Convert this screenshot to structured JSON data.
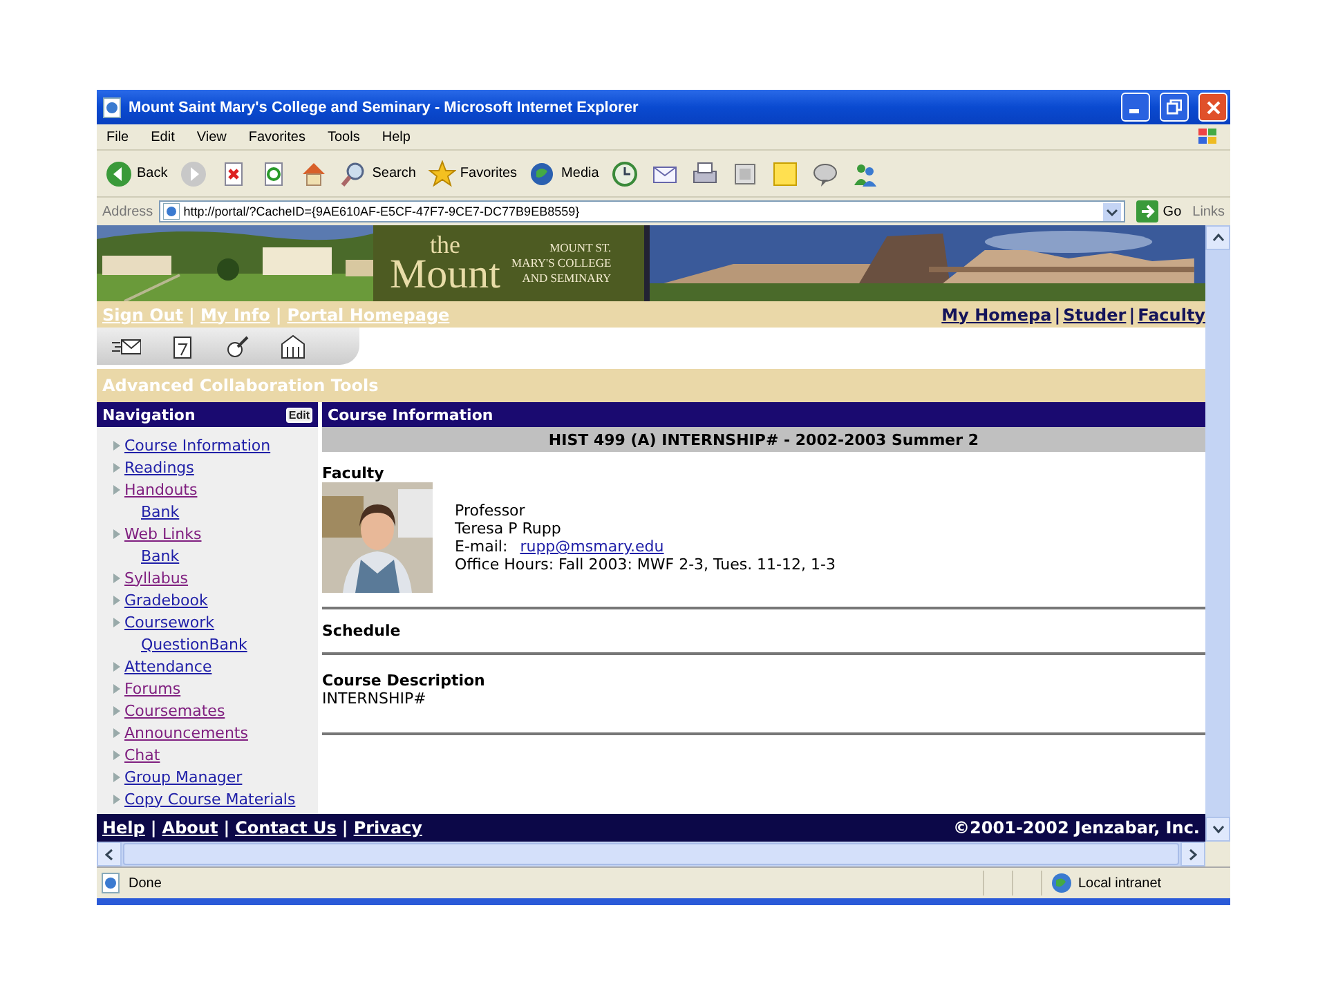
{
  "window": {
    "title": "Mount Saint Mary's College and Seminary - Microsoft Internet Explorer"
  },
  "menu": [
    "File",
    "Edit",
    "View",
    "Favorites",
    "Tools",
    "Help"
  ],
  "toolbar": [
    {
      "kind": "back",
      "label": "Back"
    },
    {
      "kind": "forward"
    },
    {
      "kind": "stop"
    },
    {
      "kind": "refresh"
    },
    {
      "kind": "home"
    },
    {
      "kind": "search",
      "label": "Search"
    },
    {
      "kind": "favorites",
      "label": "Favorites"
    },
    {
      "kind": "media",
      "label": "Media"
    },
    {
      "kind": "history"
    },
    {
      "kind": "mail"
    },
    {
      "kind": "print"
    },
    {
      "kind": "edit"
    },
    {
      "kind": "note"
    },
    {
      "kind": "discuss"
    },
    {
      "kind": "messenger"
    }
  ],
  "address": {
    "label": "Address",
    "value": "http://portal/?CacheID={9AE610AF-E5CF-47F7-9CE7-DC77B9EB8559}",
    "go": "Go",
    "links": "Links"
  },
  "banner": {
    "logo_small": "the",
    "logo_large": "Mount",
    "tagline": [
      "MOUNT ST.",
      "MARY'S COLLEGE",
      "AND SEMINARY"
    ]
  },
  "top_links": [
    "Sign Out",
    "My Info",
    "Portal Homepage"
  ],
  "tab_links": [
    "My Homepa",
    "Studer",
    "Faculty"
  ],
  "separator": "|",
  "portlet_tools": [
    {
      "kind": "mail"
    },
    {
      "kind": "calendar"
    },
    {
      "kind": "pen"
    },
    {
      "kind": "building"
    }
  ],
  "section_title": "Advanced Collaboration Tools",
  "navigation": {
    "title": "Navigation",
    "edit": "Edit",
    "items": [
      {
        "label": "Course Information",
        "visited": false
      },
      {
        "label": "Readings",
        "visited": false
      },
      {
        "label": "Handouts",
        "visited": true,
        "children": [
          {
            "label": "Bank",
            "visited": false
          }
        ]
      },
      {
        "label": "Web Links",
        "visited": true,
        "children": [
          {
            "label": "Bank",
            "visited": false
          }
        ]
      },
      {
        "label": "Syllabus",
        "visited": true
      },
      {
        "label": "Gradebook",
        "visited": false
      },
      {
        "label": "Coursework",
        "visited": false,
        "children": [
          {
            "label": "QuestionBank",
            "visited": false
          }
        ]
      },
      {
        "label": "Attendance",
        "visited": false
      },
      {
        "label": "Forums",
        "visited": true
      },
      {
        "label": "Coursemates",
        "visited": true
      },
      {
        "label": "Announcements",
        "visited": true
      },
      {
        "label": "Chat",
        "visited": true
      },
      {
        "label": "Group Manager",
        "visited": false
      },
      {
        "label": "Copy Course Materials",
        "visited": false
      }
    ]
  },
  "course": {
    "title": "Course Information",
    "heading": "HIST 499 (A) INTERNSHIP# - 2002-2003 Summer 2",
    "faculty_label": "Faculty",
    "role": "Professor",
    "name": "Teresa P Rupp",
    "email_label": "E-mail:",
    "email": "rupp@msmary.edu",
    "office_hours": "Office Hours: Fall 2003: MWF 2-3, Tues. 11-12, 1-3",
    "schedule_label": "Schedule",
    "description_label": "Course Description",
    "description": "INTERNSHIP#"
  },
  "footer": {
    "links": [
      "Help",
      "About",
      "Contact Us",
      "Privacy"
    ],
    "copyright": "©2001-2002 Jenzabar, Inc."
  },
  "status_bar": {
    "text": "Done",
    "zone": "Local intranet"
  }
}
